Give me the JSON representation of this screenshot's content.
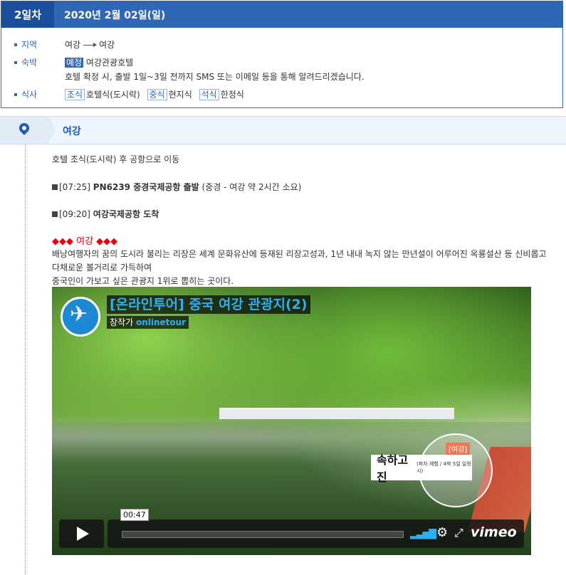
{
  "day": {
    "badge": "2일차",
    "date": "2020년 2월 02일(일)"
  },
  "info": {
    "region_label": "지역",
    "region_from": "여강",
    "region_to": "여강",
    "lodging_label": "숙박",
    "lodging_tag": "예정",
    "lodging_name": "여강관광호텔",
    "lodging_note": "호텔 확정 시, 출발 1일~3일 전까지 SMS 또는 이메일 등을 통해 알려드리겠습니다.",
    "meal_label": "식사",
    "meals": [
      {
        "tag": "조식",
        "value": "호텔식(도시락)"
      },
      {
        "tag": "중식",
        "value": "현지식"
      },
      {
        "tag": "석식",
        "value": "한정식"
      }
    ]
  },
  "location": {
    "name": "여강"
  },
  "content": {
    "line1": "호텔 조식(도시락) 후 공항으로 이동",
    "flight_time": "[07:25]",
    "flight_bold": "PN6239 중경국제공항 출발",
    "flight_note": "(중경 - 여강 약 2시간 소요)",
    "arrive_time": "[09:20]",
    "arrive_bold": "여강국제공항 도착",
    "section_title": "◆◆◆ 여강 ◆◆◆",
    "desc1": "배낭여행자의 꿈의 도시라 불리는 리장은 세계 문화유산에 등재된 리장고성과, 1년 내내 녹지 않는 만년설이 어루어진 옥룡설산 등 신비롭고",
    "desc2": "다채로운 볼거리로 가득하여",
    "desc3": "중국인이 가보고 싶은 관광지 1위로 뽑히는 곳이다."
  },
  "video": {
    "title": "[온라인투어] 중국 여강 관광지(2)",
    "author_prefix": "창작가",
    "author": "onlinetour",
    "stamp_tag": "[여강]",
    "stamp_title": "속하고진",
    "stamp_sub": "(파차 체험 / 4박 5일 일정 시)",
    "time": "00:47",
    "brand": "vimeo"
  }
}
